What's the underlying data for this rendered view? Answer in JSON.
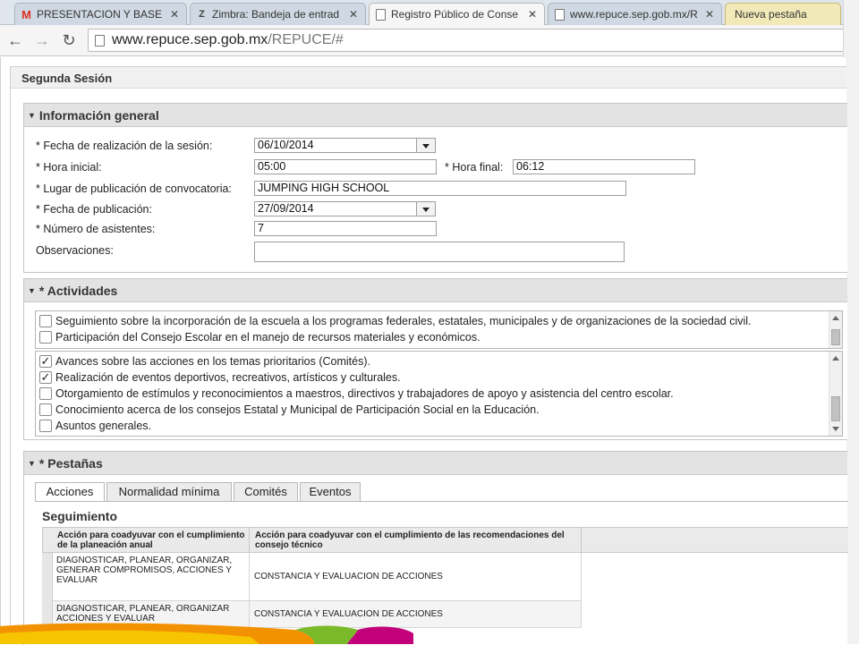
{
  "browser": {
    "tabs": [
      {
        "label": "PRESENTACION Y BASE D",
        "icon": "gmail-icon",
        "active": false
      },
      {
        "label": "Zimbra: Bandeja de entrad",
        "icon": "zimbra-icon",
        "active": false
      },
      {
        "label": "Registro Público de Conse",
        "icon": "page-icon",
        "active": true
      },
      {
        "label": "www.repuce.sep.gob.mx/R",
        "icon": "page-icon",
        "active": false
      },
      {
        "label": "Nueva pestaña",
        "icon": "",
        "active": false
      }
    ],
    "address": {
      "host": "www.repuce.sep.gob.mx",
      "path": "/REPUCE/#"
    }
  },
  "panel_title": "Segunda Sesión",
  "info": {
    "title": "Información general",
    "fecha_label": "* Fecha de realización de la sesión:",
    "fecha_value": "06/10/2014",
    "hora_inicial_label": "* Hora inicial:",
    "hora_inicial_value": "05:00",
    "hora_final_label": "* Hora final:",
    "hora_final_value": "06:12",
    "lugar_label": "* Lugar de publicación de convocatoria:",
    "lugar_value": "JUMPING HIGH SCHOOL",
    "fecha_pub_label": "* Fecha de publicación:",
    "fecha_pub_value": "27/09/2014",
    "asistentes_label": "* Número de asistentes:",
    "asistentes_value": "7",
    "observaciones_label": "Observaciones:",
    "observaciones_value": ""
  },
  "actividades": {
    "title": "* Actividades",
    "list1": [
      {
        "label": "Seguimiento sobre la incorporación de la escuela a los programas federales, estatales, municipales y de organizaciones de la sociedad civil.",
        "checked": false
      },
      {
        "label": "Participación del Consejo Escolar en el manejo de recursos materiales y económicos.",
        "checked": false
      }
    ],
    "list2": [
      {
        "label": "Avances sobre las acciones en los temas prioritarios (Comités).",
        "checked": true
      },
      {
        "label": "Realización de eventos deportivos, recreativos, artísticos y culturales.",
        "checked": true
      },
      {
        "label": "Otorgamiento de estímulos y reconocimientos a maestros, directivos y trabajadores de apoyo y asistencia del centro escolar.",
        "checked": false
      },
      {
        "label": "Conocimiento acerca de los consejos Estatal y Municipal de Participación Social en la Educación.",
        "checked": false
      },
      {
        "label": "Asuntos generales.",
        "checked": false
      }
    ]
  },
  "pestanas": {
    "title": "* Pestañas",
    "tabs": [
      "Acciones",
      "Normalidad mínima",
      "Comités",
      "Eventos"
    ],
    "grid_title": "Seguimiento",
    "columns": [
      "Acción para coadyuvar con el cumplimiento de la planeación anual",
      "Acción para coadyuvar con el cumplimiento de las recomendaciones del consejo técnico"
    ],
    "rows": [
      [
        "DIAGNOSTICAR, PLANEAR, ORGANIZAR, GENERAR COMPROMISOS, ACCIONES Y EVALUAR",
        "CONSTANCIA Y EVALUACION DE ACCIONES"
      ],
      [
        "DIAGNOSTICAR, PLANEAR, ORGANIZAR ACCIONES Y EVALUAR",
        "CONSTANCIA Y EVALUACION DE ACCIONES"
      ]
    ]
  },
  "colors": {
    "section_header": "#e3e3e3",
    "band_orange": "#f39200",
    "band_yellow": "#f6c400",
    "band_green": "#7ab929",
    "band_magenta": "#c2007a"
  }
}
